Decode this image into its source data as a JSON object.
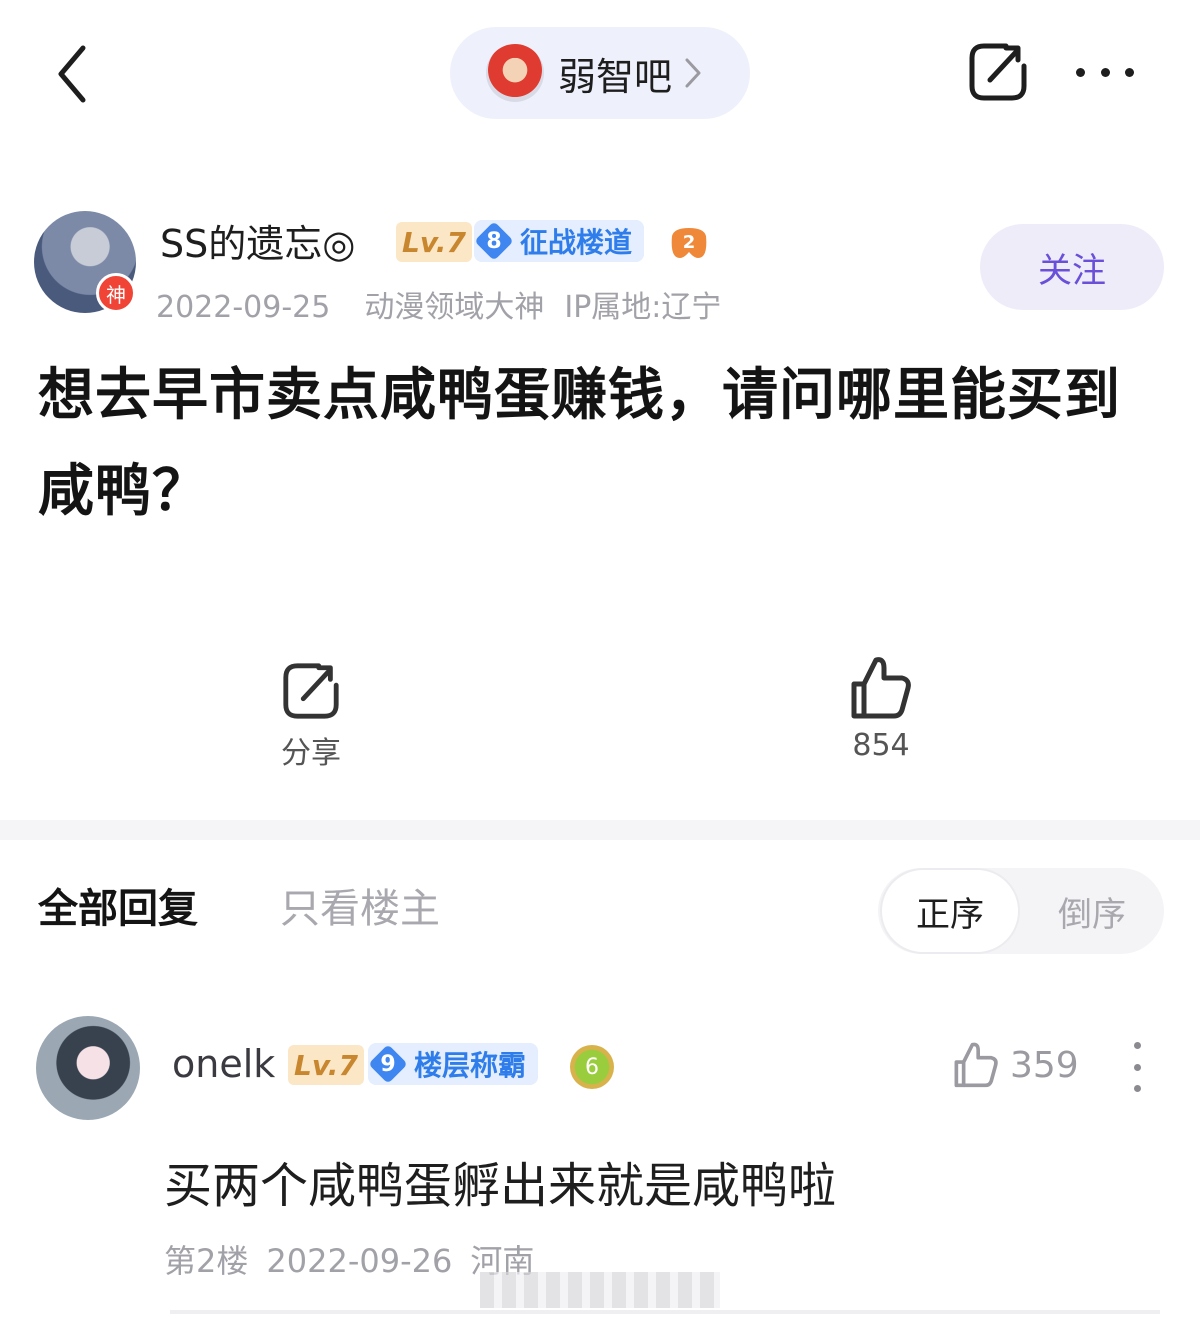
{
  "header": {
    "forum_name": "弱智吧"
  },
  "post": {
    "author": {
      "name": "SS的遗忘◎",
      "god_mark": "神",
      "level": "Lv.7",
      "rank_number": "8",
      "rank_title": "征战楼道",
      "medal_number": "2"
    },
    "date": "2022-09-25",
    "title_tag": "动漫领域大神",
    "ip_location": "IP属地:辽宁",
    "follow_label": "关注",
    "title": "想去早市卖点咸鸭蛋赚钱，请问哪里能买到咸鸭？",
    "share_label": "分享",
    "like_count": "854"
  },
  "replies_header": {
    "tab_all": "全部回复",
    "tab_op": "只看楼主",
    "sort_asc": "正序",
    "sort_desc": "倒序"
  },
  "reply": {
    "author": "onelk",
    "level": "Lv.7",
    "rank_number": "9",
    "rank_title": "楼层称霸",
    "medal_number": "6",
    "like_count": "359",
    "text": "买两个咸鸭蛋孵出来就是咸鸭啦",
    "floor": "第2楼",
    "date": "2022-09-26",
    "location": "河南"
  },
  "colors": {
    "accent_purple": "#6a4fd8",
    "rank_blue": "#2f7dea",
    "level_gold": "#c8862e"
  }
}
